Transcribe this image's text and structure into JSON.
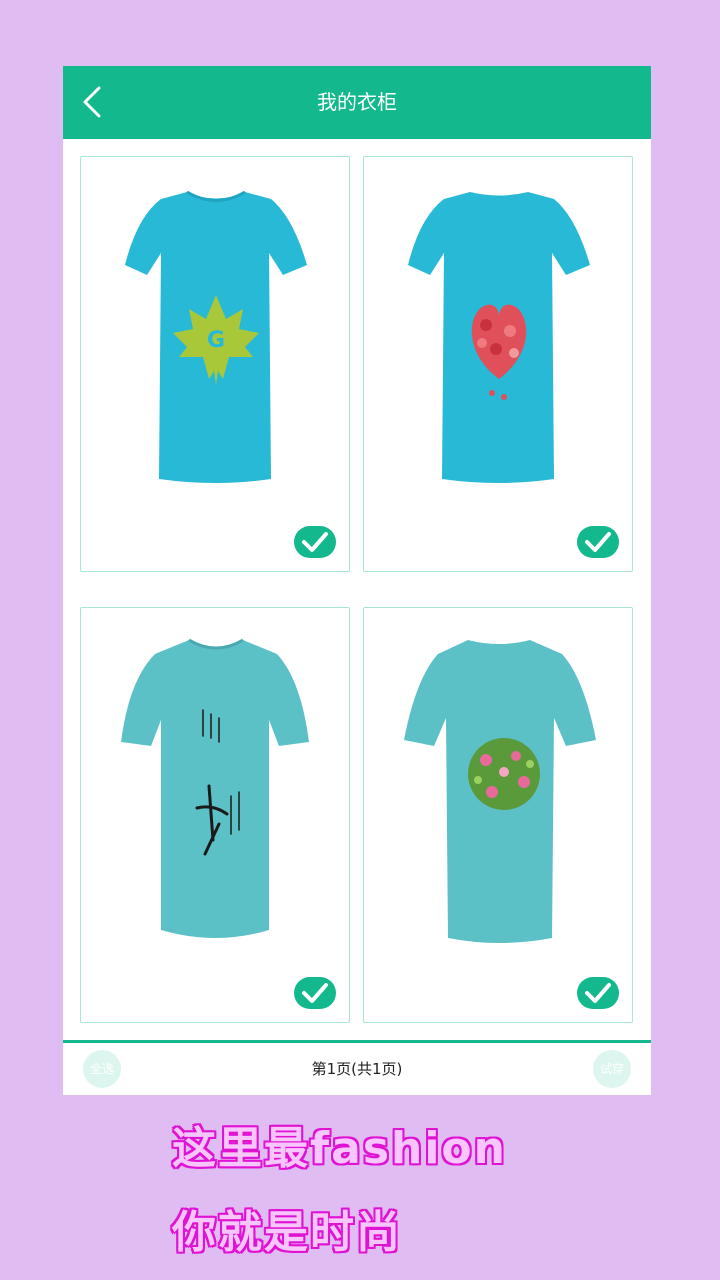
{
  "header": {
    "title": "我的衣柜",
    "back_icon": "chevron-left-icon"
  },
  "colors": {
    "accent": "#13b88d",
    "background": "#dfbcf2",
    "shirt_bright": "#27b9d6",
    "shirt_muted": "#5cc0c7",
    "slogan_stroke": "#e012d4"
  },
  "items": [
    {
      "design": "green maple leaf with letter G",
      "design_letter": "G",
      "selected": true
    },
    {
      "design": "red apple heart",
      "selected": true
    },
    {
      "design": "black calligraphy",
      "selected": true
    },
    {
      "design": "pink and green floral cluster",
      "selected": true
    }
  ],
  "footer": {
    "select_all": "全选",
    "page_info": "第1页(共1页)",
    "try_on": "试穿"
  },
  "slogans": {
    "line1": "这里最fashion",
    "line2": "你就是时尚"
  }
}
